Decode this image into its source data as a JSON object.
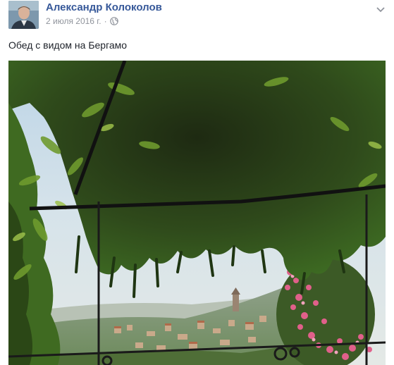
{
  "post": {
    "author": "Александр Колоколов",
    "date": "2 июля 2016 г.",
    "separator": "·",
    "text": "Обед с видом на Бергамо",
    "privacy_icon": "globe-icon",
    "menu_icon": "chevron-down-icon",
    "photo_description": "view of Bergamo through wisteria pergola"
  },
  "colors": {
    "author_link": "#365899",
    "meta_gray": "#90949c",
    "text": "#1d2129"
  }
}
